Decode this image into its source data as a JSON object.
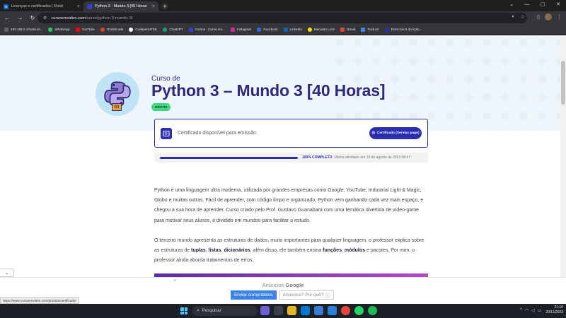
{
  "browser": {
    "tabs": [
      {
        "label": "Licenças e certificados | Relat",
        "icon": "linkedin-icon",
        "color": "#0a66c2",
        "glyph": "in",
        "active": false
      },
      {
        "label": "Python 3 - Mundo 3 [40 Horas",
        "icon": "cursoemvideo-icon",
        "color": "#3b3bd1",
        "glyph": "",
        "active": true
      }
    ],
    "new_tab": "+",
    "url_host": "cursoemvideo.com",
    "url_path": "/curso/python-3-mundo-3/"
  },
  "bookmarks": [
    {
      "label": "192.168.0.1/index.ht...",
      "color": "#5f6368"
    },
    {
      "label": "WhatsApp",
      "color": "#25d366"
    },
    {
      "label": "YouTube",
      "color": "#ff0000"
    },
    {
      "label": "Onebitcode",
      "color": "#e53935"
    },
    {
      "label": "CodepenHTML",
      "color": "#ffffff"
    },
    {
      "label": "ChatGPT",
      "color": "#10a37f"
    },
    {
      "label": "Cursos - Curso em...",
      "color": "#3b3bd1"
    },
    {
      "label": "Instagram",
      "color": "#d6249f"
    },
    {
      "label": "Facebook",
      "color": "#1877f2"
    },
    {
      "label": "LinkedIn",
      "color": "#0a66c2"
    },
    {
      "label": "Mercado Livre",
      "color": "#ffe600"
    },
    {
      "label": "Gmail",
      "color": "#ea4335"
    },
    {
      "label": "Traduzir",
      "color": "#4285f4"
    },
    {
      "label": "Exercício 5 da lição...",
      "color": "#2b2db0"
    }
  ],
  "course": {
    "kicker": "Curso de",
    "title": "Python 3 – Mundo 3 [40 Horas]",
    "badge": "GRÁTIS",
    "logo_number": "03"
  },
  "certificate": {
    "message": "Certificado disponível para emissão.",
    "button_label": "Certificado (Serviço pago)"
  },
  "progress": {
    "percent": 100,
    "label": "100% COMPLETO",
    "activity": "Última atividade em 19 de agosto de 2023 08:47"
  },
  "description": {
    "p1": "Python é uma linguagem ultra moderna, utilizada por grandes empresas como Google, YouTube, Industrial Light & Magic, Globo e muitas outras. Fácil de aprender, com código limpo e organizado, Python vem ganhando cada vez mais espaço, e chegou a sua hora de aprender. Curso criado pelo Prof. Gustavo Guanabara com uma temática divertida de vídeo-game para motivar seus alunos, é dividido em mundos para facilitar o estudo.",
    "p2_a": "O terceiro mundo apresenta as estruturas de dados, muito importantes para qualquer linguagem, o professor explica sobre as estruturas de ",
    "p2_tuplas": "tuplas",
    "p2_sep1": ", ",
    "p2_listas": "listas",
    "p2_sep2": ", ",
    "p2_dicionarios": "dicionários",
    "p2_b": ", além disso, ele também ensina ",
    "p2_funcoes": "funções",
    "p2_sep3": ", ",
    "p2_modulos": "módulos",
    "p2_c": " e pacotes. Por mim, o professor ainda aborda tratamentos de erros."
  },
  "ads": {
    "label_prefix": "Anúncios",
    "label_brand": "Google",
    "send_feedback": "Enviar comentários",
    "why": "Anúncios? Por quê?"
  },
  "status_url": "https://www.cursoemvideo.com/produto/certificado/",
  "taskbar": {
    "search_placeholder": "Pesquisar",
    "time": "21:10",
    "date": "20/11/2023"
  }
}
